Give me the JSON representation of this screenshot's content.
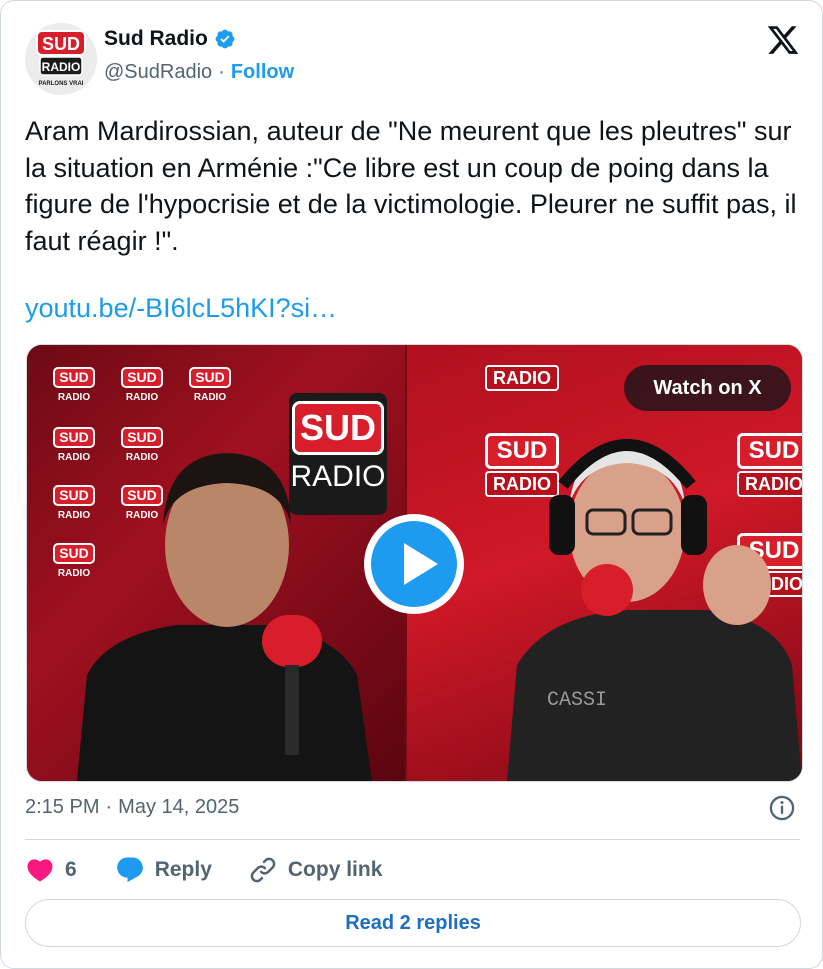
{
  "author": {
    "name": "Sud Radio",
    "handle": "@SudRadio",
    "separator": "·",
    "follow_label": "Follow",
    "avatar": {
      "line1": "SUD",
      "line2": "RADIO",
      "line3": "PARLONS VRAI"
    }
  },
  "tweet": {
    "text": "Aram Mardirossian, auteur de \"Ne meurent que les pleutres\" sur la situation en Arménie :\"Ce libre est un coup de poing dans la figure de l'hypocrisie et de la victimologie. Pleurer ne suffit pas, il faut réagir !\".",
    "link": "youtu.be/-BI6lcL5hKI?si…"
  },
  "media": {
    "watch_label": "Watch on X",
    "logo_sud": "SUD",
    "logo_radio": "RADIO",
    "logo_tagline": "PARLONS VRAI",
    "shirt_text": "CASSI"
  },
  "meta": {
    "time": "2:15 PM",
    "separator": "·",
    "date": "May 14, 2025"
  },
  "actions": {
    "likes": "6",
    "reply_label": "Reply",
    "copy_label": "Copy link"
  },
  "read_replies_label": "Read 2 replies",
  "colors": {
    "accent": "#1d9bf0",
    "heart": "#f91880",
    "text": "#0f1419",
    "muted": "#536471",
    "border": "#cfd9de",
    "brand_red": "#d81e2a"
  }
}
